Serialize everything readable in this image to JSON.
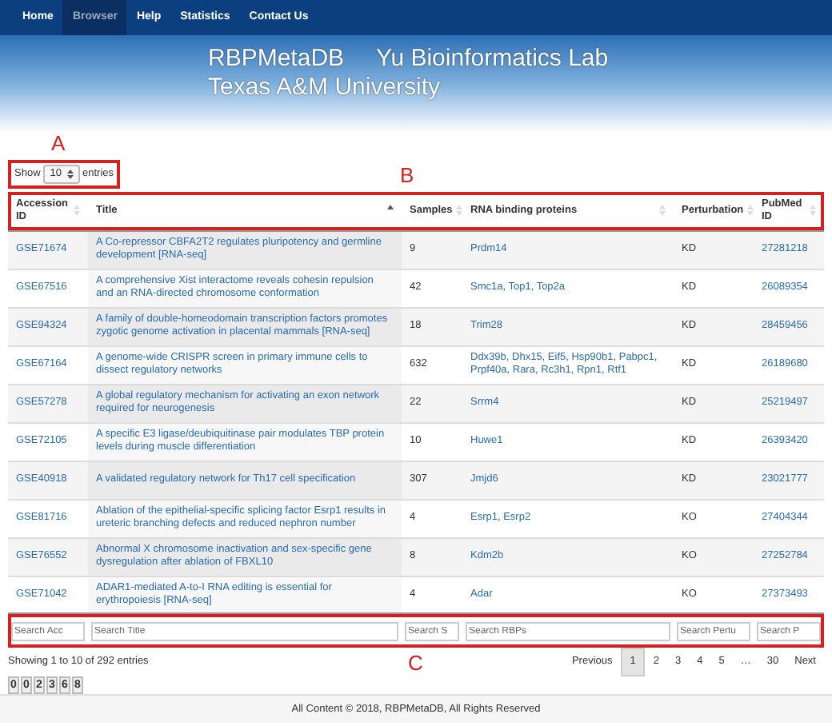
{
  "nav": [
    {
      "label": "Home",
      "selected": false
    },
    {
      "label": "Browser",
      "selected": true
    },
    {
      "label": "Help",
      "selected": false
    },
    {
      "label": "Statistics",
      "selected": false
    },
    {
      "label": "Contact Us",
      "selected": false
    }
  ],
  "banner": {
    "title_1": "RBPMetaDB",
    "title_2": "Yu Bioinformatics Lab",
    "subtitle": "Texas A&M University"
  },
  "annotations": {
    "a": "A",
    "b": "B",
    "c": "C"
  },
  "length_menu": {
    "label_before": "Show",
    "value": "10",
    "label_after": "entries"
  },
  "table": {
    "columns": [
      {
        "label": "Accession ID",
        "sorted": false
      },
      {
        "label": "Title",
        "sorted": true
      },
      {
        "label": "Samples",
        "sorted": false
      },
      {
        "label": "RNA binding proteins",
        "sorted": false
      },
      {
        "label": "Perturbation",
        "sorted": false
      },
      {
        "label": "PubMed ID",
        "sorted": false
      }
    ],
    "rows": [
      {
        "accession": "GSE71674",
        "title": "A Co-repressor CBFA2T2 regulates pluripotency and germline development [RNA-seq]",
        "samples": "9",
        "rbps": "Prdm14",
        "perturbation": "KD",
        "pubmed": "27281218"
      },
      {
        "accession": "GSE67516",
        "title": "A comprehensive Xist interactome reveals cohesin repulsion and an RNA-directed chromosome conformation",
        "samples": "42",
        "rbps": "Smc1a, Top1, Top2a",
        "perturbation": "KD",
        "pubmed": "26089354"
      },
      {
        "accession": "GSE94324",
        "title": "A family of double-homeodomain transcription factors promotes zygotic genome activation in placental mammals [RNA-seq]",
        "samples": "18",
        "rbps": "Trim28",
        "perturbation": "KD",
        "pubmed": "28459456"
      },
      {
        "accession": "GSE67164",
        "title": "A genome-wide CRISPR screen in primary immune cells to dissect regulatory networks",
        "samples": "632",
        "rbps": "Ddx39b, Dhx15, Eif5, Hsp90b1, Pabpc1, Prpf40a, Rara, Rc3h1, Rpn1, Rtf1",
        "perturbation": "KD",
        "pubmed": "26189680"
      },
      {
        "accession": "GSE57278",
        "title": "A global regulatory mechanism for activating an exon network required for neurogenesis",
        "samples": "22",
        "rbps": "Srrm4",
        "perturbation": "KD",
        "pubmed": "25219497"
      },
      {
        "accession": "GSE72105",
        "title": "A specific E3 ligase/deubiquitinase pair modulates TBP protein levels during muscle differentiation",
        "samples": "10",
        "rbps": "Huwe1",
        "perturbation": "KD",
        "pubmed": "26393420"
      },
      {
        "accession": "GSE40918",
        "title": "A validated regulatory network for Th17 cell specification",
        "samples": "307",
        "rbps": "Jmjd6",
        "perturbation": "KD",
        "pubmed": "23021777"
      },
      {
        "accession": "GSE81716",
        "title": "Ablation of the epithelial-specific splicing factor Esrp1 results in ureteric branching defects and reduced nephron number",
        "samples": "4",
        "rbps": "Esrp1, Esrp2",
        "perturbation": "KO",
        "pubmed": "27404344"
      },
      {
        "accession": "GSE76552",
        "title": "Abnormal X chromosome inactivation and sex-specific gene dysregulation after ablation of FBXL10",
        "samples": "8",
        "rbps": "Kdm2b",
        "perturbation": "KO",
        "pubmed": "27252784"
      },
      {
        "accession": "GSE71042",
        "title": "ADAR1-mediated A-to-I RNA editing is essential for erythropoiesis [RNA-seq]",
        "samples": "4",
        "rbps": "Adar",
        "perturbation": "KO",
        "pubmed": "27373493"
      }
    ],
    "search_fields": [
      {
        "placeholder": "Search Acc"
      },
      {
        "placeholder": "Search Title"
      },
      {
        "placeholder": "Search S"
      },
      {
        "placeholder": "Search RBPs"
      },
      {
        "placeholder": "Search Pertu"
      },
      {
        "placeholder": "Search P"
      }
    ]
  },
  "info": "Showing 1 to 10 of 292 entries",
  "pagination": [
    {
      "label": "Previous",
      "selected": false
    },
    {
      "label": "1",
      "selected": true
    },
    {
      "label": "2",
      "selected": false
    },
    {
      "label": "3",
      "selected": false
    },
    {
      "label": "4",
      "selected": false
    },
    {
      "label": "5",
      "selected": false
    },
    {
      "label": "…",
      "selected": false
    },
    {
      "label": "30",
      "selected": false
    },
    {
      "label": "Next",
      "selected": false
    }
  ],
  "counter": [
    "0",
    "0",
    "2",
    "3",
    "6",
    "8"
  ],
  "footer": "All Content © 2018, RBPMetaDB, All Rights Reserved"
}
